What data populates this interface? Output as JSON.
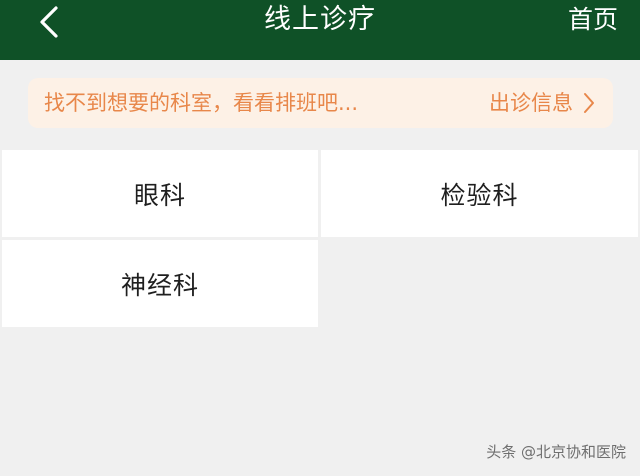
{
  "header": {
    "title": "线上诊疗",
    "back_icon": "chevron-left-icon",
    "home_label": "首页",
    "background_color": "#0f5127"
  },
  "notice": {
    "text": "找不到想要的科室，看看排班吧...",
    "link_label": "出诊信息",
    "link_icon": "chevron-right-icon",
    "text_color": "#e8874a",
    "background_color": "#fdf1e6"
  },
  "departments": [
    {
      "label": "眼科"
    },
    {
      "label": "检验科"
    },
    {
      "label": "神经科"
    }
  ],
  "watermark": "头条 @北京协和医院"
}
